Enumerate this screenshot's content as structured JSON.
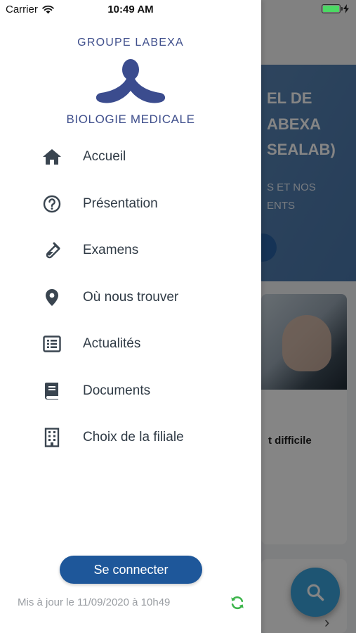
{
  "status_bar": {
    "carrier": "Carrier",
    "time": "10:49 AM",
    "battery_color": "#4cd964"
  },
  "drawer": {
    "logo": {
      "top_text": "GROUPE LABEXA",
      "bottom_text": "BIOLOGIE MEDICALE",
      "color": "#3f4f8c"
    },
    "menu": [
      {
        "label": "Accueil",
        "icon": "home-icon"
      },
      {
        "label": "Présentation",
        "icon": "question-circle-icon"
      },
      {
        "label": "Examens",
        "icon": "test-tube-icon"
      },
      {
        "label": "Où nous trouver",
        "icon": "map-pin-icon"
      },
      {
        "label": "Actualités",
        "icon": "list-icon"
      },
      {
        "label": "Documents",
        "icon": "book-icon"
      },
      {
        "label": "Choix de la filiale",
        "icon": "building-icon"
      }
    ],
    "login_button": "Se connecter",
    "last_update": "Mis à jour le 11/09/2020 à 10h49",
    "refresh_icon": "refresh-icon",
    "accent_color": "#1e579a"
  },
  "background": {
    "hero_lines": [
      "EL DE",
      "ABEXA",
      "SEALAB)"
    ],
    "hero_sub_lines": [
      "S ET NOS",
      "ENTS"
    ],
    "card_text": "t difficile",
    "fab_icon": "search-icon",
    "chevron_icon": "chevron-right-icon"
  }
}
